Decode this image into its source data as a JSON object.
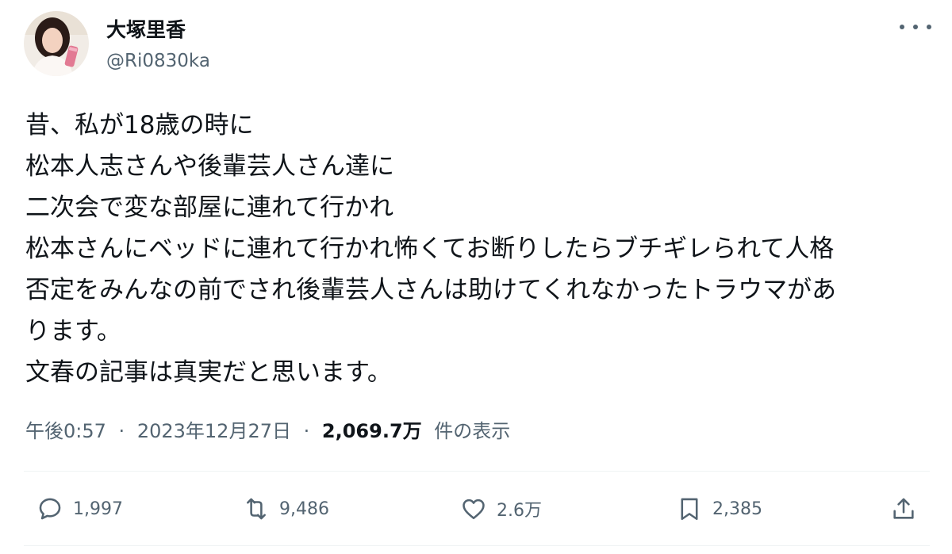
{
  "author": {
    "display_name": "大塚里香",
    "handle": "@Ri0830ka"
  },
  "tweet": {
    "lines": [
      "昔、私が18歳の時に",
      "松本人志さんや後輩芸人さん達に",
      "二次会で変な部屋に連れて行かれ",
      "松本さんにベッドに連れて行かれ怖くてお断りしたらブチギレられて人格",
      "否定をみんなの前でされ後輩芸人さんは助けてくれなかったトラウマがあ",
      "ります。",
      "文春の記事は真実だと思います。"
    ],
    "time": "午後0:57",
    "date": "2023年12月27日",
    "separator": "·",
    "views_count": "2,069.7万",
    "views_label": "件の表示"
  },
  "actions": {
    "replies": "1,997",
    "reposts": "9,486",
    "likes": "2.6万",
    "bookmarks": "2,385"
  },
  "icons": {
    "more": "more-horizontal-icon",
    "reply": "reply-icon",
    "repost": "repost-icon",
    "like": "heart-icon",
    "bookmark": "bookmark-icon",
    "share": "share-icon"
  },
  "colors": {
    "text_primary": "#0f1419",
    "text_secondary": "#536471",
    "divider": "#eff3f4"
  }
}
